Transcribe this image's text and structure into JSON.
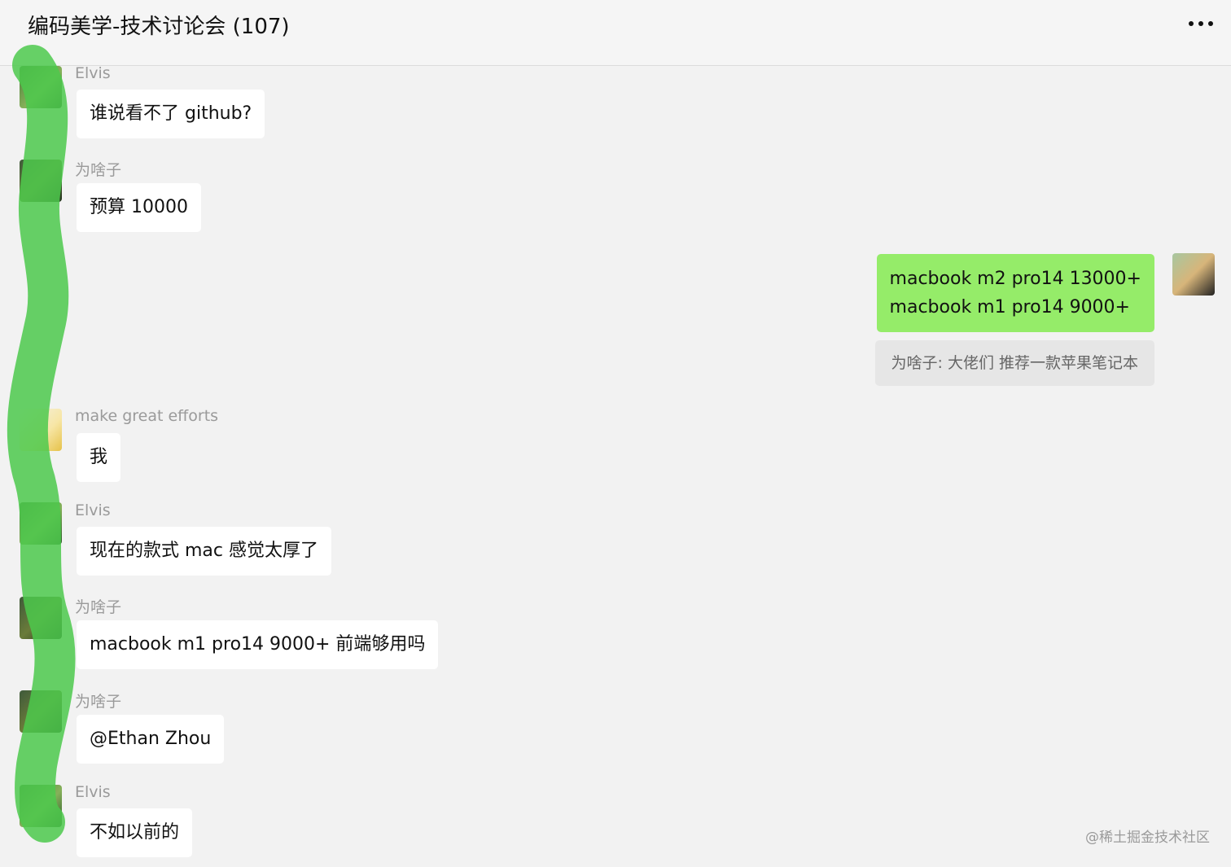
{
  "header": {
    "title": "编码美学-技术讨论会 (107)"
  },
  "messages": {
    "m1": {
      "sender": "Elvis",
      "text": "谁说看不了 github?"
    },
    "m2": {
      "sender": "为啥子",
      "text": "预算 10000"
    },
    "m3": {
      "line1": "macbook m2 pro14 13000+",
      "line2": "macbook m1 pro14 9000+"
    },
    "m3_quote": "为啥子: 大佬们  推荐一款苹果笔记本",
    "m4": {
      "sender": "make great efforts",
      "text": "我"
    },
    "m5": {
      "sender": "Elvis",
      "text": "现在的款式 mac 感觉太厚了"
    },
    "m6": {
      "sender": "为啥子",
      "text": "macbook m1 pro14 9000+  前端够用吗"
    },
    "m7": {
      "sender": "为啥子",
      "text": "@Ethan Zhou"
    },
    "m8": {
      "sender": "Elvis",
      "text": "不如以前的"
    }
  },
  "watermark": "@稀土掘金技术社区",
  "colors": {
    "background": "#f2f2f2",
    "incoming_bubble": "#ffffff",
    "outgoing_bubble": "#95ec69",
    "highlight_stroke": "#4cc94c"
  },
  "icons": {
    "more": "more-dots-icon"
  }
}
